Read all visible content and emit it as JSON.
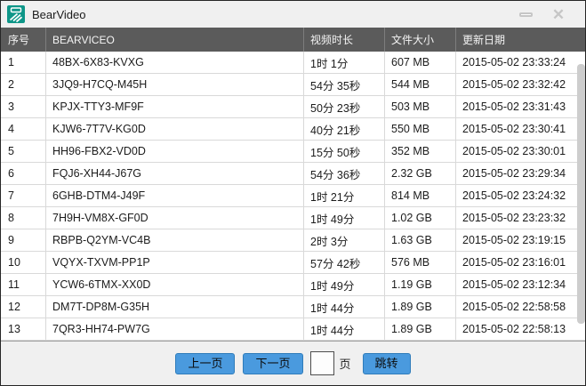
{
  "window": {
    "title": "BearVideo",
    "icons": {
      "logo": "bearvideo-logo",
      "minimize": "minimize-bar",
      "close": "✕"
    }
  },
  "table": {
    "columns": [
      "序号",
      "BEARVICEO",
      "视频时长",
      "文件大小",
      "更新日期"
    ],
    "rows": [
      {
        "index": "1",
        "name": "48BX-6X83-KVXG",
        "duration": "1时 1分",
        "size": "607 MB",
        "updated": "2015-05-02 23:33:24"
      },
      {
        "index": "2",
        "name": "3JQ9-H7CQ-M45H",
        "duration": "54分 35秒",
        "size": "544 MB",
        "updated": "2015-05-02 23:32:42"
      },
      {
        "index": "3",
        "name": "KPJX-TTY3-MF9F",
        "duration": "50分 23秒",
        "size": "503 MB",
        "updated": "2015-05-02 23:31:43"
      },
      {
        "index": "4",
        "name": "KJW6-7T7V-KG0D",
        "duration": "40分 21秒",
        "size": "550 MB",
        "updated": "2015-05-02 23:30:41"
      },
      {
        "index": "5",
        "name": "HH96-FBX2-VD0D",
        "duration": "15分 50秒",
        "size": "352 MB",
        "updated": "2015-05-02 23:30:01"
      },
      {
        "index": "6",
        "name": "FQJ6-XH44-J67G",
        "duration": "54分 36秒",
        "size": "2.32 GB",
        "updated": "2015-05-02 23:29:34"
      },
      {
        "index": "7",
        "name": "6GHB-DTM4-J49F",
        "duration": "1时 21分",
        "size": "814 MB",
        "updated": "2015-05-02 23:24:32"
      },
      {
        "index": "8",
        "name": "7H9H-VM8X-GF0D",
        "duration": "1时 49分",
        "size": "1.02 GB",
        "updated": "2015-05-02 23:23:32"
      },
      {
        "index": "9",
        "name": "RBPB-Q2YM-VC4B",
        "duration": "2时 3分",
        "size": "1.63 GB",
        "updated": "2015-05-02 23:19:15"
      },
      {
        "index": "10",
        "name": "VQYX-TXVM-PP1P",
        "duration": "57分 42秒",
        "size": "576 MB",
        "updated": "2015-05-02 23:16:01"
      },
      {
        "index": "11",
        "name": "YCW6-6TMX-XX0D",
        "duration": "1时 49分",
        "size": "1.19 GB",
        "updated": "2015-05-02 23:12:34"
      },
      {
        "index": "12",
        "name": "DM7T-DP8M-G35H",
        "duration": "1时 44分",
        "size": "1.89 GB",
        "updated": "2015-05-02 22:58:58"
      },
      {
        "index": "13",
        "name": "7QR3-HH74-PW7G",
        "duration": "1时 44分",
        "size": "1.89 GB",
        "updated": "2015-05-02 22:58:13"
      }
    ]
  },
  "pagination": {
    "prev_label": "上一页",
    "next_label": "下一页",
    "page_input_value": "",
    "page_unit_label": "页",
    "jump_label": "跳转"
  },
  "colors": {
    "accent_blue": "#4a9ade",
    "header_bg": "#5b5b5b",
    "logo_teal": "#0e9688",
    "titlebar_bg": "#f0f0f0"
  }
}
